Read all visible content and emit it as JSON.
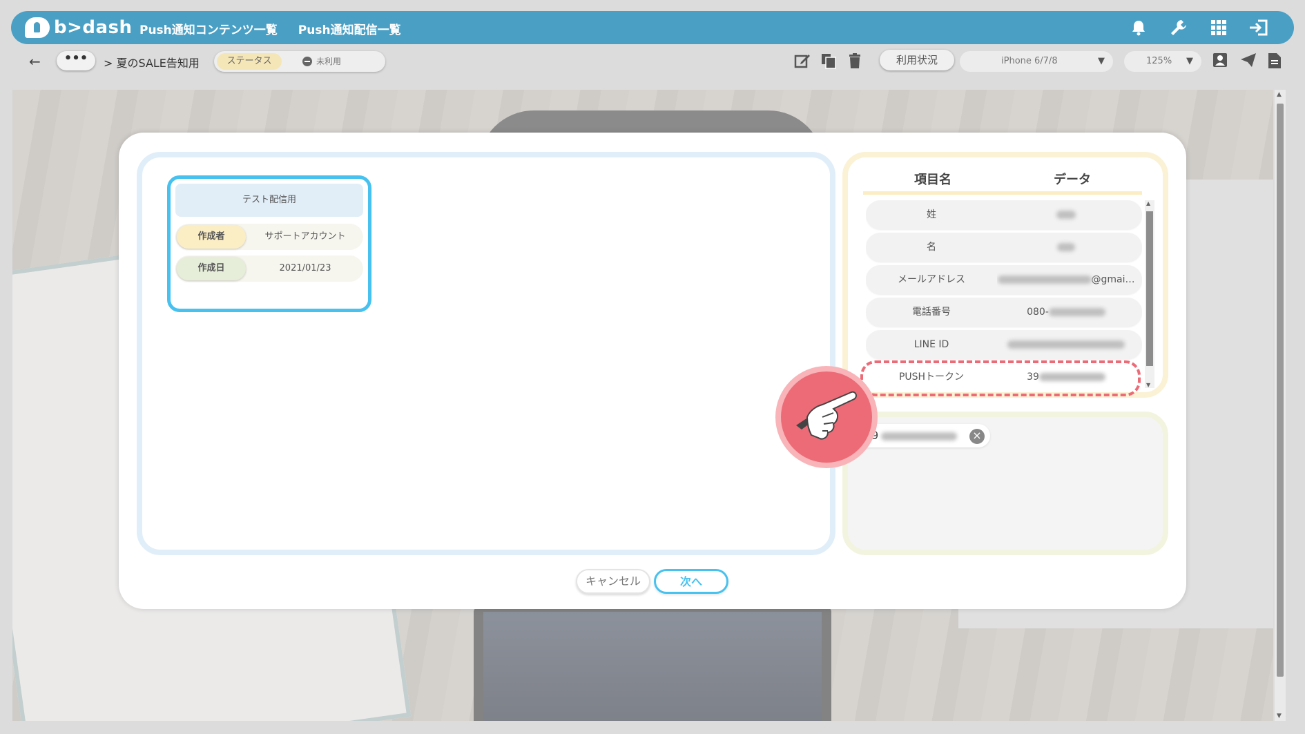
{
  "header": {
    "logo_text": "b>dash",
    "nav": [
      "Push通知コンテンツ一覧",
      "Push通知配信一覧"
    ],
    "icons": [
      "bell-icon",
      "wrench-icon",
      "grid-icon",
      "logout-icon"
    ],
    "color": "#4a9fc4"
  },
  "toolbar": {
    "back_label": "←",
    "more_label": "•••",
    "breadcrumb": "> 夏のSALE告知用",
    "status_label": "ステータス",
    "status_value": "未利用",
    "usage_label": "利用状況",
    "device_select": "iPhone 6/7/8",
    "zoom_select": "125%",
    "icons": [
      "edit-icon",
      "copy-icon",
      "trash-icon",
      "profile-icon",
      "send-icon",
      "document-icon"
    ]
  },
  "modal": {
    "card": {
      "title": "テスト配信用",
      "rows": [
        {
          "label": "作成者",
          "value": "サポートアカウント"
        },
        {
          "label": "作成日",
          "value": "2021/01/23"
        }
      ]
    },
    "table": {
      "headers": [
        "項目名",
        "データ"
      ],
      "rows": [
        {
          "label": "姓",
          "value": ""
        },
        {
          "label": "名",
          "value": ""
        },
        {
          "label": "メールアドレス",
          "value": "@gmai…"
        },
        {
          "label": "電話番号",
          "value": "080-"
        },
        {
          "label": "LINE ID",
          "value": ""
        },
        {
          "label": "PUSHトークン",
          "value": "39"
        }
      ]
    },
    "chip_value": "39",
    "cancel_label": "キャンセル",
    "next_label": "次へ",
    "accent_color": "#47c1ef",
    "highlight_color": "#ec6b77"
  }
}
